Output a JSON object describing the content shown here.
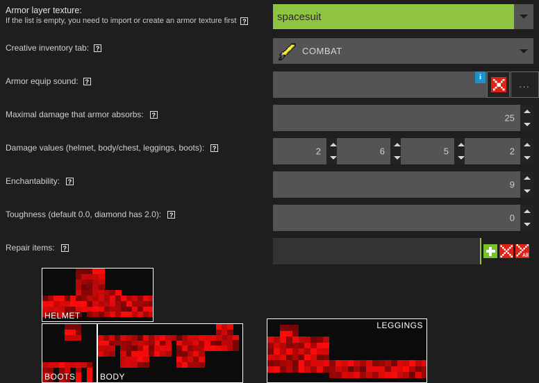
{
  "window": {
    "background": "#1e1e1e",
    "accent_green": "#8ec43f",
    "field_bg": "#545454"
  },
  "form": {
    "rows": [
      {
        "label": "Armor layer texture:",
        "sublabel": "If the list is empty, you need to import or create an armor texture first",
        "help": "?"
      },
      {
        "label": "Creative inventory tab:",
        "help": "?"
      },
      {
        "label": "Armor equip sound:",
        "help": "?"
      },
      {
        "label": "Maximal damage that armor absorbs:",
        "help": "?"
      },
      {
        "label": "Damage values (helmet, body/chest, leggings, boots):",
        "help": "?"
      },
      {
        "label": "Enchantability:",
        "help": "?"
      },
      {
        "label": "Toughness (default 0.0, diamond has 2.0):",
        "help": "?"
      },
      {
        "label": "Repair items:",
        "help": "?"
      }
    ]
  },
  "controls": {
    "armor_texture": {
      "value": "spacesuit",
      "selected": true,
      "arrow_icon": "chevron-down-icon"
    },
    "creative_tab": {
      "value": "COMBAT",
      "icon": "golden-sword-icon",
      "arrow_icon": "chevron-down-icon"
    },
    "equip_sound": {
      "value": "",
      "info_badge": "i",
      "clear_icon": "red-x-icon",
      "browse_label": "..."
    },
    "max_damage_absorbed": {
      "value": "25"
    },
    "damage_values": [
      {
        "name": "helmet",
        "value": "2"
      },
      {
        "name": "body-chest",
        "value": "6"
      },
      {
        "name": "leggings",
        "value": "5"
      },
      {
        "name": "boots",
        "value": "2"
      }
    ],
    "enchantability": {
      "value": "9"
    },
    "toughness": {
      "value": "0"
    },
    "repair_items": {
      "value": "",
      "add_icon": "green-plus-icon",
      "remove_icon": "red-x-icon",
      "remove_all_icon": "red-x-all-icon",
      "remove_all_label": "All"
    }
  },
  "previews": [
    {
      "caption": "HELMET",
      "position": "bottom-left"
    },
    {
      "caption": "BOOTS",
      "position": "bottom-left"
    },
    {
      "caption": "BODY",
      "position": "bottom-left"
    },
    {
      "caption": "LEGGINGS",
      "position": "top-right"
    }
  ]
}
